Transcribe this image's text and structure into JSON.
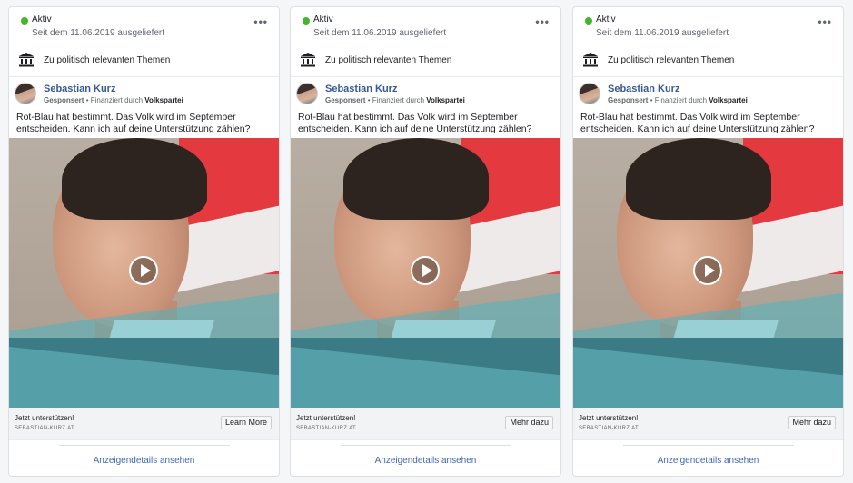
{
  "ads": [
    {
      "status": "Aktiv",
      "date": "Seit dem 11.06.2019 ausgeliefert",
      "topic": "Zu politisch relevanten Themen",
      "advertiser": "Sebastian Kurz",
      "sponsored": "Gesponsert",
      "funded_by": " • Finanziert durch ",
      "party": "Volkspartei",
      "text": "Rot-Blau hat bestimmt. Das Volk wird im September entscheiden. Kann ich auf deine Unterstützung zählen?",
      "cta_headline": "Jetzt unterstützen!",
      "cta_domain": "SEBASTIAN-KURZ.AT",
      "cta_button": "Learn More",
      "details_link": "Anzeigendetails ansehen",
      "more": "•••"
    },
    {
      "status": "Aktiv",
      "date": "Seit dem 11.06.2019 ausgeliefert",
      "topic": "Zu politisch relevanten Themen",
      "advertiser": "Sebastian Kurz",
      "sponsored": "Gesponsert",
      "funded_by": " • Finanziert durch ",
      "party": "Volkspartei",
      "text": "Rot-Blau hat bestimmt. Das Volk wird im September entscheiden. Kann ich auf deine Unterstützung zählen?",
      "cta_headline": "Jetzt unterstützen!",
      "cta_domain": "SEBASTIAN-KURZ.AT",
      "cta_button": "Mehr dazu",
      "details_link": "Anzeigendetails ansehen",
      "more": "•••"
    },
    {
      "status": "Aktiv",
      "date": "Seit dem 11.06.2019 ausgeliefert",
      "topic": "Zu politisch relevanten Themen",
      "advertiser": "Sebastian Kurz",
      "sponsored": "Gesponsert",
      "funded_by": " • Finanziert durch ",
      "party": "Volkspartei",
      "text": "Rot-Blau hat bestimmt. Das Volk wird im September entscheiden. Kann ich auf deine Unterstützung zählen?",
      "cta_headline": "Jetzt unterstützen!",
      "cta_domain": "SEBASTIAN-KURZ.AT",
      "cta_button": "Mehr dazu",
      "details_link": "Anzeigendetails ansehen",
      "more": "•••"
    }
  ],
  "colors": {
    "status_active": "#42b72a",
    "link": "#4267b2",
    "advertiser_name": "#385898"
  },
  "icons": {
    "status": "green-dot-icon",
    "topic": "government-building-icon",
    "media": "play-icon",
    "menu": "more-options-icon"
  }
}
